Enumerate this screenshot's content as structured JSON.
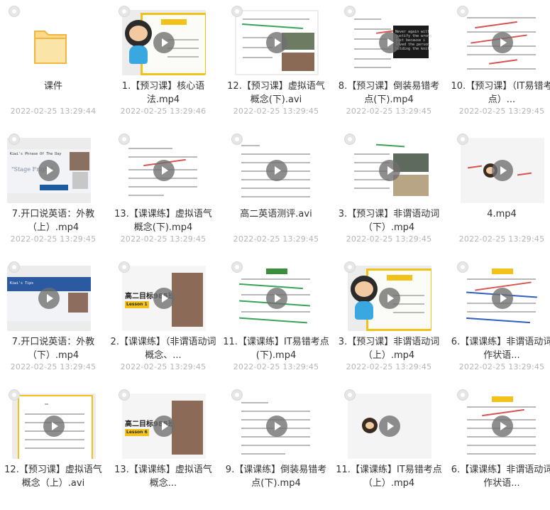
{
  "items": [
    {
      "name": "课件",
      "date": "2022-02-25 13:29:44",
      "thumb": "folder-icon"
    },
    {
      "name": "1.【预习课】核心语法.mp4",
      "date": "2022-02-25 13:29:46",
      "thumb": "video-thumbnail"
    },
    {
      "name": "12.【预习课】虚拟语气概念(下).avi",
      "date": "2022-02-25 13:29:45",
      "thumb": "video-thumbnail"
    },
    {
      "name": "8.【预习课】倒装易错考点(下).mp4",
      "date": "2022-02-25 13:29:45",
      "thumb": "video-thumbnail"
    },
    {
      "name": "10.【预习课】（IT易错考点）...",
      "date": "2022-02-25 13:29:45",
      "thumb": "video-thumbnail"
    },
    {
      "name": "7.开口说英语：外教（上）.mp4",
      "date": "2022-02-25 13:29:45",
      "thumb": "video-thumbnail"
    },
    {
      "name": "13.【课课练】虚拟语气概念(下).mp4",
      "date": "2022-02-25 13:29:45",
      "thumb": "video-thumbnail"
    },
    {
      "name": "高二英语测评.avi",
      "date": "2022-02-25 13:29:45",
      "thumb": "video-thumbnail"
    },
    {
      "name": "3.【预习课】非谓语动词（下）.mp4",
      "date": "2022-02-25 13:29:45",
      "thumb": "video-thumbnail"
    },
    {
      "name": "4.mp4",
      "date": "2022-02-25 13:29:45",
      "thumb": "video-thumbnail"
    },
    {
      "name": "7.开口说英语：外教（下）.mp4",
      "date": "2022-02-25 13:29:45",
      "thumb": "video-thumbnail"
    },
    {
      "name": "2.【课课练】（非谓语动词概念、...",
      "date": "2022-02-25 13:29:45",
      "thumb": "video-thumbnail"
    },
    {
      "name": "11.【课课练】IT易错考点(下).mp4",
      "date": "2022-02-25 13:29:45",
      "thumb": "video-thumbnail"
    },
    {
      "name": "3.【预习课】非谓语动词（上）.mp4",
      "date": "2022-02-25 13:29:45",
      "thumb": "video-thumbnail"
    },
    {
      "name": "6.【课课练】非谓语动词作状语...",
      "date": "2022-02-25 13:29:45",
      "thumb": "video-thumbnail"
    },
    {
      "name": "12.【预习课】虚拟语气概念（上）.avi",
      "date": "",
      "thumb": "video-thumbnail"
    },
    {
      "name": "13.【课课练】虚拟语气概念...",
      "date": "",
      "thumb": "video-thumbnail"
    },
    {
      "name": "9.【课课练】倒装易错考点(下).mp4",
      "date": "",
      "thumb": "video-thumbnail"
    },
    {
      "name": "11.【课课练】IT易错考点（上）.mp4",
      "date": "",
      "thumb": "video-thumbnail"
    },
    {
      "name": "6.【课课练】非谓语动词作状语...",
      "date": "",
      "thumb": "video-thumbnail"
    }
  ],
  "thumb_text": {
    "sign1": "Never again will\njustify the wrong\njust because i\nloved the person\nholding the knife.",
    "slide1": "Kiwi's Phrase Of The Day",
    "slide1_sub": "\"Stage Fright\"",
    "slide2": "Kiwi's Tips",
    "goal": "高二目标985班",
    "lesson1": "Lesson 1",
    "lesson6": "Lesson 6"
  },
  "colors": {
    "name": "#333333",
    "date": "#b5b5b5",
    "folder": "#f7c86a",
    "accent_yellow": "#f2c21a"
  }
}
